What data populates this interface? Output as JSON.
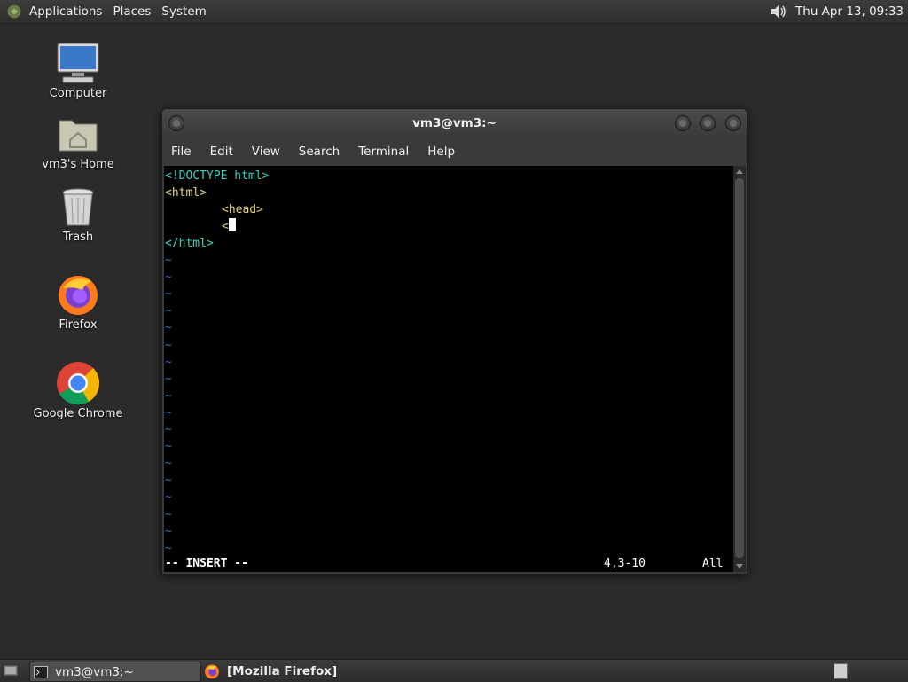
{
  "top_panel": {
    "menus": [
      "Applications",
      "Places",
      "System"
    ],
    "clock": "Thu Apr 13, 09:33"
  },
  "desktop": {
    "icons": [
      {
        "label": "Computer",
        "icon": "computer-icon"
      },
      {
        "label": "vm3's Home",
        "icon": "home-folder-icon"
      },
      {
        "label": "Trash",
        "icon": "trash-icon"
      },
      {
        "label": "Firefox",
        "icon": "firefox-icon"
      },
      {
        "label": "Google Chrome",
        "icon": "chrome-icon"
      }
    ]
  },
  "terminal": {
    "title": "vm3@vm3:~",
    "menu": [
      "File",
      "Edit",
      "View",
      "Search",
      "Terminal",
      "Help"
    ],
    "lines": {
      "l1": "<!DOCTYPE html>",
      "l2": "<html>",
      "l3": "<head>",
      "l4": "<",
      "l5": "</html>"
    },
    "tilde": "~",
    "status_mode": "-- INSERT --",
    "cursor_pos": "4,3-10",
    "scroll_pos": "All"
  },
  "taskbar": {
    "tasks": [
      {
        "label": "vm3@vm3:~",
        "icon": "terminal-icon",
        "active": true
      },
      {
        "label": "[Mozilla Firefox]",
        "icon": "firefox-icon",
        "active": false
      }
    ]
  },
  "colors": {
    "desktop_bg": "#2b2b2b",
    "terminal_bg": "#000000",
    "tag_color": "#3fd0c0",
    "tilde_color": "#3b6fbf"
  }
}
